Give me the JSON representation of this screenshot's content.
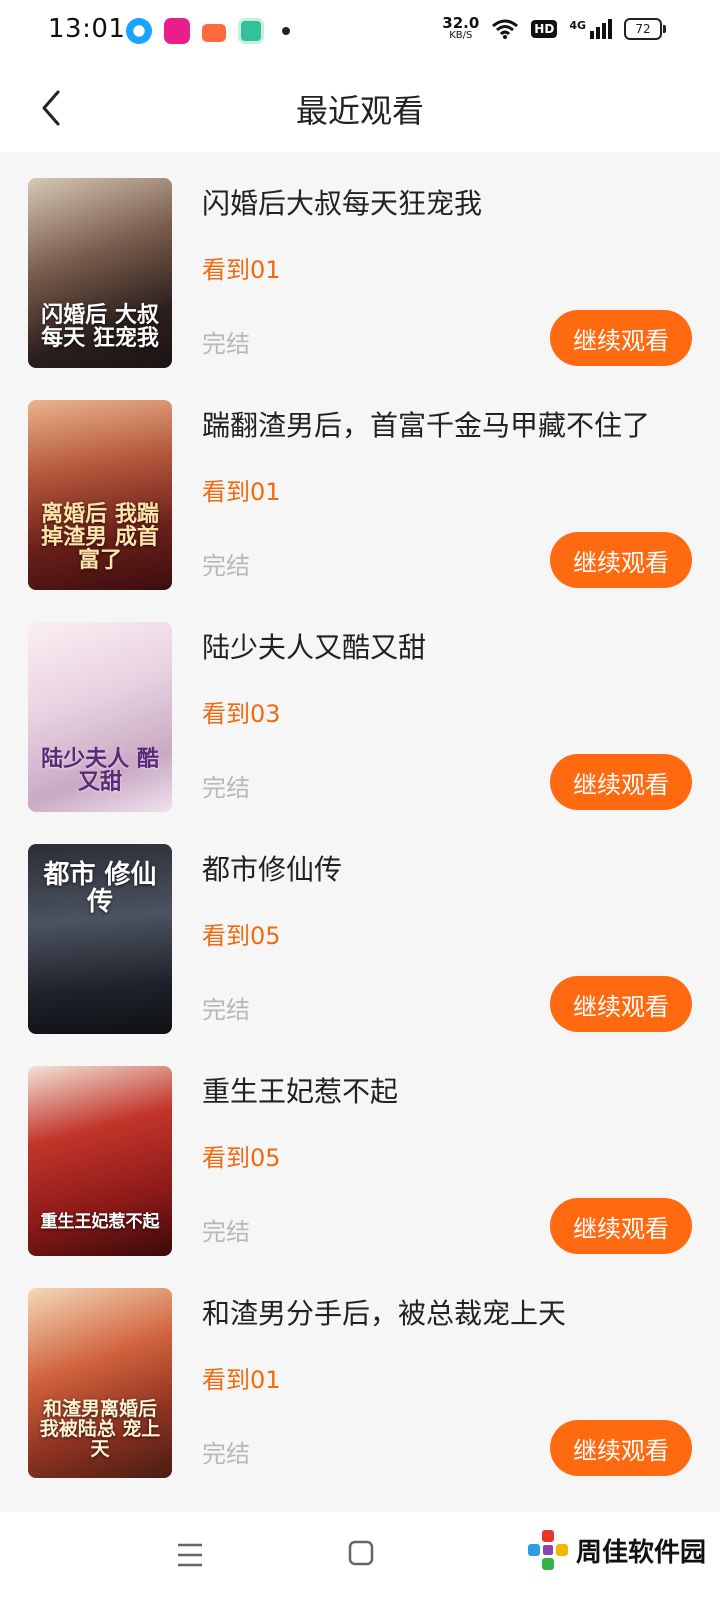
{
  "status_bar": {
    "time": "13:01",
    "net_speed_value": "32.0",
    "net_speed_unit": "KB/S",
    "hd_label": "HD",
    "network_label": "4G",
    "battery_level": "72"
  },
  "header": {
    "title": "最近观看",
    "back_icon": "chevron-left-icon"
  },
  "items": [
    {
      "title": "闪婚后大叔每天狂宠我",
      "progress": "看到01",
      "status": "完结",
      "button": "继续观看",
      "cover_text": "闪婚后 大叔每天 狂宠我"
    },
    {
      "title": "踹翻渣男后，首富千金马甲藏不住了",
      "progress": "看到01",
      "status": "完结",
      "button": "继续观看",
      "cover_text": "离婚后 我踹掉渣男 成首富了"
    },
    {
      "title": "陆少夫人又酷又甜",
      "progress": "看到03",
      "status": "完结",
      "button": "继续观看",
      "cover_text": "陆少夫人 酷又甜"
    },
    {
      "title": "都市修仙传",
      "progress": "看到05",
      "status": "完结",
      "button": "继续观看",
      "cover_text": "都市 修仙传"
    },
    {
      "title": "重生王妃惹不起",
      "progress": "看到05",
      "status": "完结",
      "button": "继续观看",
      "cover_text": "重生王妃惹不起"
    },
    {
      "title": "和渣男分手后，被总裁宠上天",
      "progress": "看到01",
      "status": "完结",
      "button": "继续观看",
      "cover_text": "和渣男离婚后 我被陆总 宠上天"
    }
  ],
  "bottom_nav": {
    "menu_icon": "menu-icon",
    "home_icon": "home-square-icon"
  },
  "watermark": {
    "text": "周佳软件园"
  },
  "colors": {
    "accent": "#ff6a10",
    "progress_text": "#f06a10",
    "muted_text": "#b8b8b8",
    "background": "#f6f6f6"
  }
}
